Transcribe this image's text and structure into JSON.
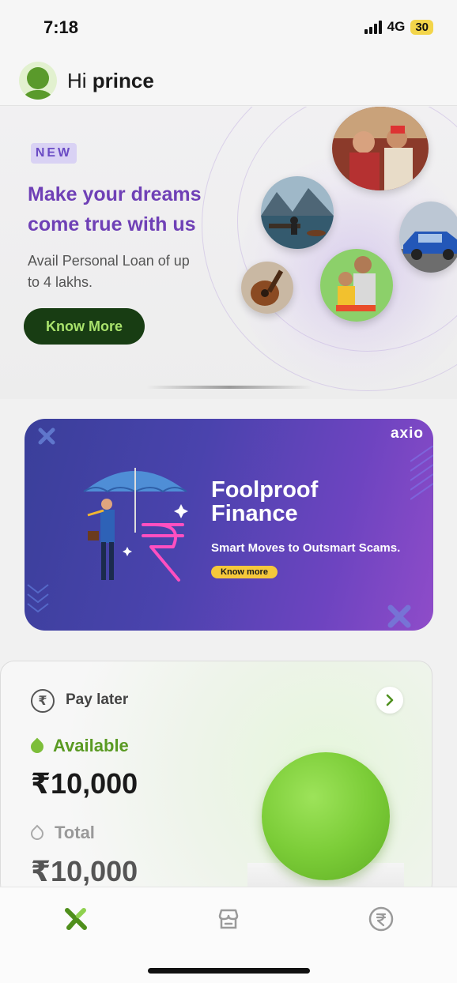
{
  "status_bar": {
    "time": "7:18",
    "network": "4G",
    "battery": "30"
  },
  "greeting": {
    "hi": "Hi",
    "name": "prince"
  },
  "promo": {
    "badge": "NEW",
    "title": "Make your dreams come true with us",
    "subtitle": "Avail Personal Loan of up to 4 lakhs.",
    "button_label": "Know More"
  },
  "scam_banner": {
    "brand": "axio",
    "headline_line1": "Foolproof",
    "headline_line2": "Finance",
    "tagline": "Smart Moves to Outsmart Scams.",
    "button_label": "Know more"
  },
  "pay_later": {
    "title": "Pay later",
    "available_label": "Available",
    "available_amount": "₹10,000",
    "total_label": "Total",
    "total_amount": "₹10,000",
    "rupee_symbol": "₹"
  },
  "nav": {
    "items": [
      {
        "icon": "axio-home-icon"
      },
      {
        "icon": "store-icon"
      },
      {
        "icon": "rupee-icon"
      }
    ]
  },
  "colors": {
    "accent_purple": "#6f40b6",
    "button_dark_green": "#183d13",
    "button_text_green": "#a9e26c",
    "available_green": "#5a9a23",
    "coin_green": "#7ccd38",
    "banner_yellow": "#f6c83b"
  }
}
